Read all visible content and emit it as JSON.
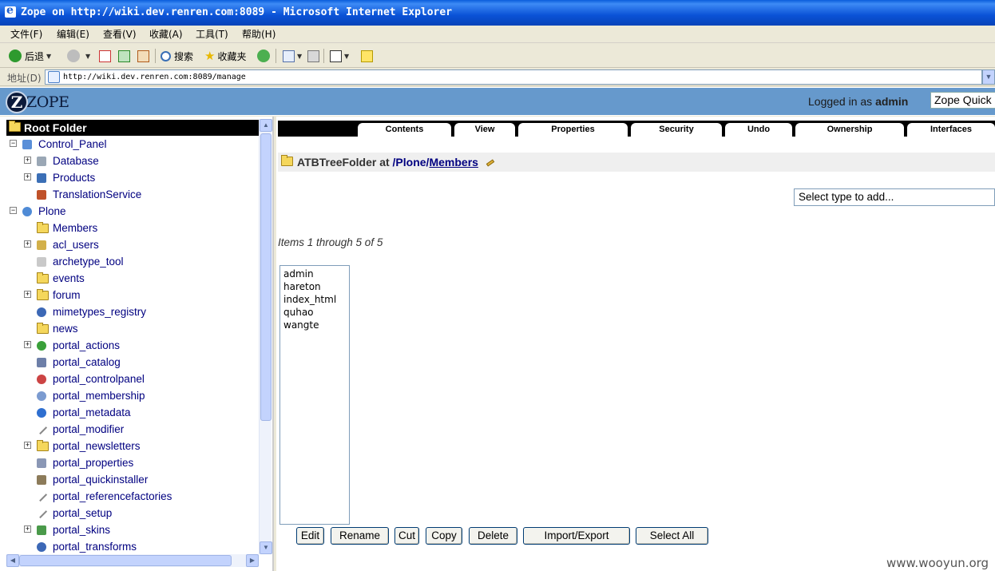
{
  "window": {
    "title": "Zope on http://wiki.dev.renren.com:8089 - Microsoft Internet Explorer"
  },
  "menu": {
    "items": [
      "文件(F)",
      "编辑(E)",
      "查看(V)",
      "收藏(A)",
      "工具(T)",
      "帮助(H)"
    ]
  },
  "toolbar": {
    "back_label": "后退",
    "search_label": "搜索",
    "favorites_label": "收藏夹"
  },
  "address": {
    "label": "地址(D)",
    "url": "http://wiki.dev.renren.com:8089/manage"
  },
  "zope_header": {
    "logo_text": "ZOPE",
    "logged_prefix": "Logged in as",
    "user": "admin",
    "quick_start": "Zope Quick"
  },
  "tree": {
    "root": "Root Folder",
    "nodes": [
      {
        "label": "Control_Panel",
        "icon": "control-panel-icon",
        "expand": "−"
      },
      {
        "label": "Database",
        "icon": "database-icon",
        "expand": "+"
      },
      {
        "label": "Products",
        "icon": "products-icon",
        "expand": "+"
      },
      {
        "label": "TranslationService",
        "icon": "translation-icon",
        "expand": ""
      },
      {
        "label": "Plone",
        "icon": "plone-icon",
        "expand": "−"
      },
      {
        "label": "Members",
        "icon": "folder-icon",
        "expand": ""
      },
      {
        "label": "acl_users",
        "icon": "users-icon",
        "expand": "+"
      },
      {
        "label": "archetype_tool",
        "icon": "archetype-icon",
        "expand": ""
      },
      {
        "label": "events",
        "icon": "folder-icon",
        "expand": ""
      },
      {
        "label": "forum",
        "icon": "folder-icon",
        "expand": "+"
      },
      {
        "label": "mimetypes_registry",
        "icon": "mimetypes-icon",
        "expand": ""
      },
      {
        "label": "news",
        "icon": "folder-icon",
        "expand": ""
      },
      {
        "label": "portal_actions",
        "icon": "actions-icon",
        "expand": "+"
      },
      {
        "label": "portal_catalog",
        "icon": "catalog-icon",
        "expand": ""
      },
      {
        "label": "portal_controlpanel",
        "icon": "controlpanel-icon",
        "expand": ""
      },
      {
        "label": "portal_membership",
        "icon": "membership-icon",
        "expand": ""
      },
      {
        "label": "portal_metadata",
        "icon": "info-icon",
        "expand": ""
      },
      {
        "label": "portal_modifier",
        "icon": "wrench-icon",
        "expand": ""
      },
      {
        "label": "portal_newsletters",
        "icon": "folder-icon",
        "expand": "+"
      },
      {
        "label": "portal_properties",
        "icon": "properties-icon",
        "expand": ""
      },
      {
        "label": "portal_quickinstaller",
        "icon": "installer-icon",
        "expand": ""
      },
      {
        "label": "portal_referencefactories",
        "icon": "wrench-icon",
        "expand": ""
      },
      {
        "label": "portal_setup",
        "icon": "wrench-icon",
        "expand": ""
      },
      {
        "label": "portal_skins",
        "icon": "skins-icon",
        "expand": "+"
      },
      {
        "label": "portal_transforms",
        "icon": "transforms-icon",
        "expand": ""
      }
    ]
  },
  "tabs": [
    "Contents",
    "View",
    "Properties",
    "Security",
    "Undo",
    "Ownership",
    "Interfaces"
  ],
  "location": {
    "prefix": "ATBTreeFolder at",
    "path": "/Plone/",
    "current": "Members"
  },
  "add_select": {
    "placeholder": "Select type to add..."
  },
  "items_summary": "Items 1 through 5 of 5",
  "items": [
    "admin",
    "hareton",
    "index_html",
    "quhao",
    "wangte"
  ],
  "buttons": [
    "Edit",
    "Rename",
    "Cut",
    "Copy",
    "Delete",
    "Import/Export",
    "Select All"
  ],
  "watermark": "www.wooyun.org"
}
